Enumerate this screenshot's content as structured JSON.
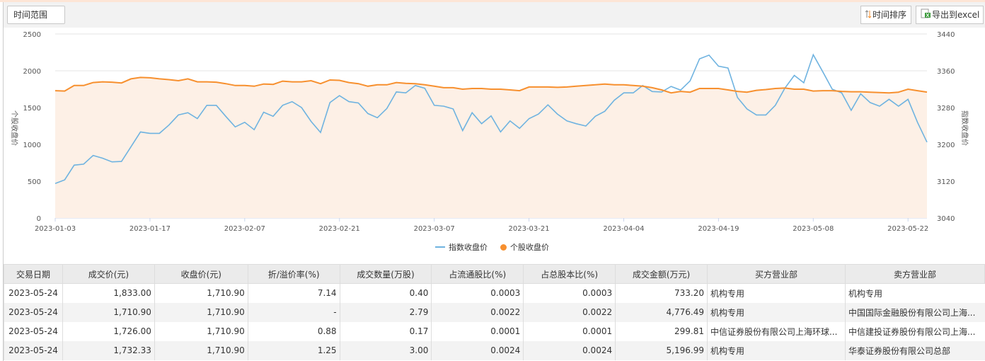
{
  "toolbar": {
    "range_label": "时间范围",
    "sort_label": "时间排序",
    "export_label": "导出到excel"
  },
  "colors": {
    "index_line": "#6fb3e0",
    "stock_line": "#f7902f",
    "area_fill": "#fdf0e6"
  },
  "chart_data": {
    "type": "line",
    "left_axis": {
      "title": "个股收盘价",
      "ylim": [
        0,
        2500
      ],
      "ticks": [
        "0",
        "500",
        "1000",
        "1500",
        "2000",
        "2500"
      ]
    },
    "right_axis": {
      "title": "指数收盘价",
      "ylim": [
        3040,
        3440
      ],
      "ticks": [
        "3040",
        "3120",
        "3200",
        "3280",
        "3360",
        "3440"
      ]
    },
    "x_ticks": [
      {
        "index": 0,
        "label": "2023-01-03"
      },
      {
        "index": 10,
        "label": "2023-01-17"
      },
      {
        "index": 20,
        "label": "2023-02-07"
      },
      {
        "index": 30,
        "label": "2023-02-21"
      },
      {
        "index": 40,
        "label": "2023-03-07"
      },
      {
        "index": 50,
        "label": "2023-03-21"
      },
      {
        "index": 60,
        "label": "2023-04-04"
      },
      {
        "index": 70,
        "label": "2023-04-19"
      },
      {
        "index": 80,
        "label": "2023-05-08"
      },
      {
        "index": 90,
        "label": "2023-05-22"
      }
    ],
    "grid": true,
    "legend_position": "bottom-center",
    "series": [
      {
        "name": "指数收盘价",
        "axis": "right",
        "values": [
          3115,
          3123,
          3155,
          3157,
          3176,
          3170,
          3162,
          3163,
          3195,
          3227,
          3224,
          3224,
          3242,
          3264,
          3269,
          3256,
          3285,
          3285,
          3261,
          3238,
          3248,
          3232,
          3270,
          3261,
          3285,
          3293,
          3280,
          3250,
          3226,
          3291,
          3306,
          3293,
          3290,
          3267,
          3258,
          3278,
          3314,
          3312,
          3328,
          3322,
          3285,
          3283,
          3277,
          3230,
          3269,
          3245,
          3262,
          3227,
          3251,
          3235,
          3256,
          3266,
          3286,
          3266,
          3251,
          3245,
          3240,
          3261,
          3272,
          3296,
          3312,
          3312,
          3328,
          3315,
          3314,
          3326,
          3318,
          3338,
          3386,
          3394,
          3370,
          3366,
          3302,
          3277,
          3264,
          3264,
          3285,
          3322,
          3350,
          3334,
          3395,
          3358,
          3320,
          3312,
          3274,
          3310,
          3291,
          3283,
          3298,
          3283,
          3298,
          3248,
          3205
        ]
      },
      {
        "name": "个股收盘价",
        "axis": "left",
        "values": [
          1730,
          1725,
          1800,
          1800,
          1840,
          1850,
          1845,
          1835,
          1890,
          1910,
          1905,
          1890,
          1880,
          1865,
          1890,
          1850,
          1850,
          1845,
          1825,
          1800,
          1800,
          1790,
          1820,
          1815,
          1860,
          1850,
          1850,
          1865,
          1825,
          1875,
          1870,
          1840,
          1825,
          1790,
          1810,
          1810,
          1840,
          1830,
          1825,
          1810,
          1790,
          1770,
          1770,
          1750,
          1760,
          1760,
          1750,
          1750,
          1740,
          1730,
          1780,
          1780,
          1780,
          1775,
          1780,
          1790,
          1800,
          1810,
          1820,
          1810,
          1810,
          1800,
          1790,
          1770,
          1740,
          1700,
          1720,
          1710,
          1760,
          1760,
          1760,
          1740,
          1720,
          1710,
          1735,
          1745,
          1760,
          1765,
          1750,
          1750,
          1725,
          1730,
          1730,
          1720,
          1715,
          1715,
          1710,
          1705,
          1700,
          1710,
          1750,
          1730,
          1711
        ]
      }
    ]
  },
  "table": {
    "headers": [
      "交易日期",
      "成交价(元)",
      "收盘价(元)",
      "折/溢价率(%)",
      "成交数量(万股)",
      "占流通股比(%)",
      "占总股本比(%)",
      "成交金额(万元)",
      "买方营业部",
      "卖方营业部"
    ],
    "rows": [
      [
        "2023-05-24",
        "1,833.00",
        "1,710.90",
        "7.14",
        "0.40",
        "0.0003",
        "0.0003",
        "733.20",
        "机构专用",
        "机构专用"
      ],
      [
        "2023-05-24",
        "1,710.90",
        "1,710.90",
        "-",
        "2.79",
        "0.0022",
        "0.0022",
        "4,776.49",
        "机构专用",
        "中国国际金融股份有限公司上海..."
      ],
      [
        "2023-05-24",
        "1,726.00",
        "1,710.90",
        "0.88",
        "0.17",
        "0.0001",
        "0.0001",
        "299.81",
        "中信证券股份有限公司上海环球...",
        "中信建投证券股份有限公司上海..."
      ],
      [
        "2023-05-24",
        "1,732.33",
        "1,710.90",
        "1.25",
        "3.00",
        "0.0024",
        "0.0024",
        "5,196.99",
        "机构专用",
        "华泰证券股份有限公司总部"
      ]
    ]
  }
}
